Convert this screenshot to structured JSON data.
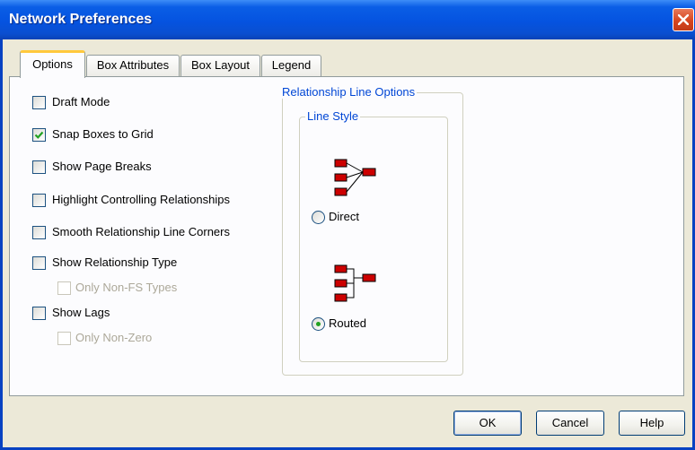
{
  "window": {
    "title": "Network Preferences"
  },
  "tabs": [
    "Options",
    "Box Attributes",
    "Box Layout",
    "Legend"
  ],
  "options": {
    "draft_mode": {
      "label": "Draft Mode",
      "checked": false
    },
    "snap_boxes": {
      "label": "Snap Boxes to Grid",
      "checked": true
    },
    "show_page_breaks": {
      "label": "Show Page Breaks",
      "checked": false
    },
    "highlight_controlling": {
      "label": "Highlight Controlling Relationships",
      "checked": false
    },
    "smooth_corners": {
      "label": "Smooth Relationship Line Corners",
      "checked": false
    },
    "show_rel_type": {
      "label": "Show Relationship Type",
      "checked": false
    },
    "only_non_fs": {
      "label": "Only Non-FS Types",
      "checked": false,
      "disabled": true
    },
    "show_lags": {
      "label": "Show Lags",
      "checked": false
    },
    "only_non_zero": {
      "label": "Only Non-Zero",
      "checked": false,
      "disabled": true
    }
  },
  "relationship_group": {
    "caption": "Relationship Line Options",
    "line_style": {
      "caption": "Line Style",
      "direct_label": "Direct",
      "routed_label": "Routed",
      "selected": "routed"
    }
  },
  "buttons": {
    "ok": "OK",
    "cancel": "Cancel",
    "help": "Help"
  },
  "colors": {
    "accent": "#0046d5",
    "titlebar": "#0553e0",
    "icon_box": "#cc0000"
  }
}
